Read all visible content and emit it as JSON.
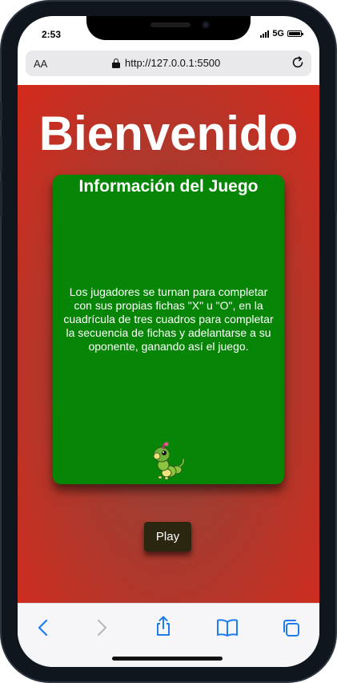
{
  "status_bar": {
    "time": "2:53",
    "network": "5G"
  },
  "browser": {
    "text_size_label": "AA",
    "url": "http://127.0.0.1:5500"
  },
  "page": {
    "title": "Bienvenido",
    "info_card": {
      "title": "Información del Juego",
      "body": "Los jugadores se turnan para completar con sus propias fichas \"X\" u \"O\", en la cuadrícula de tres cuadros para completar la secuencia de fichas y adelantarse a su oponente, ganando así el juego.",
      "image_icon": "caterpie-sprite-icon"
    },
    "play_button_label": "Play"
  },
  "toolbar": {
    "items": [
      "back-icon",
      "forward-icon",
      "share-icon",
      "bookmarks-icon",
      "tabs-icon"
    ]
  },
  "colors": {
    "page_gradient_edge": "#d42a1c",
    "page_gradient_center": "#8a4a40",
    "card_background": "#078507",
    "play_button_background": "#2a2610",
    "browser_accent": "#1e7bf0"
  }
}
